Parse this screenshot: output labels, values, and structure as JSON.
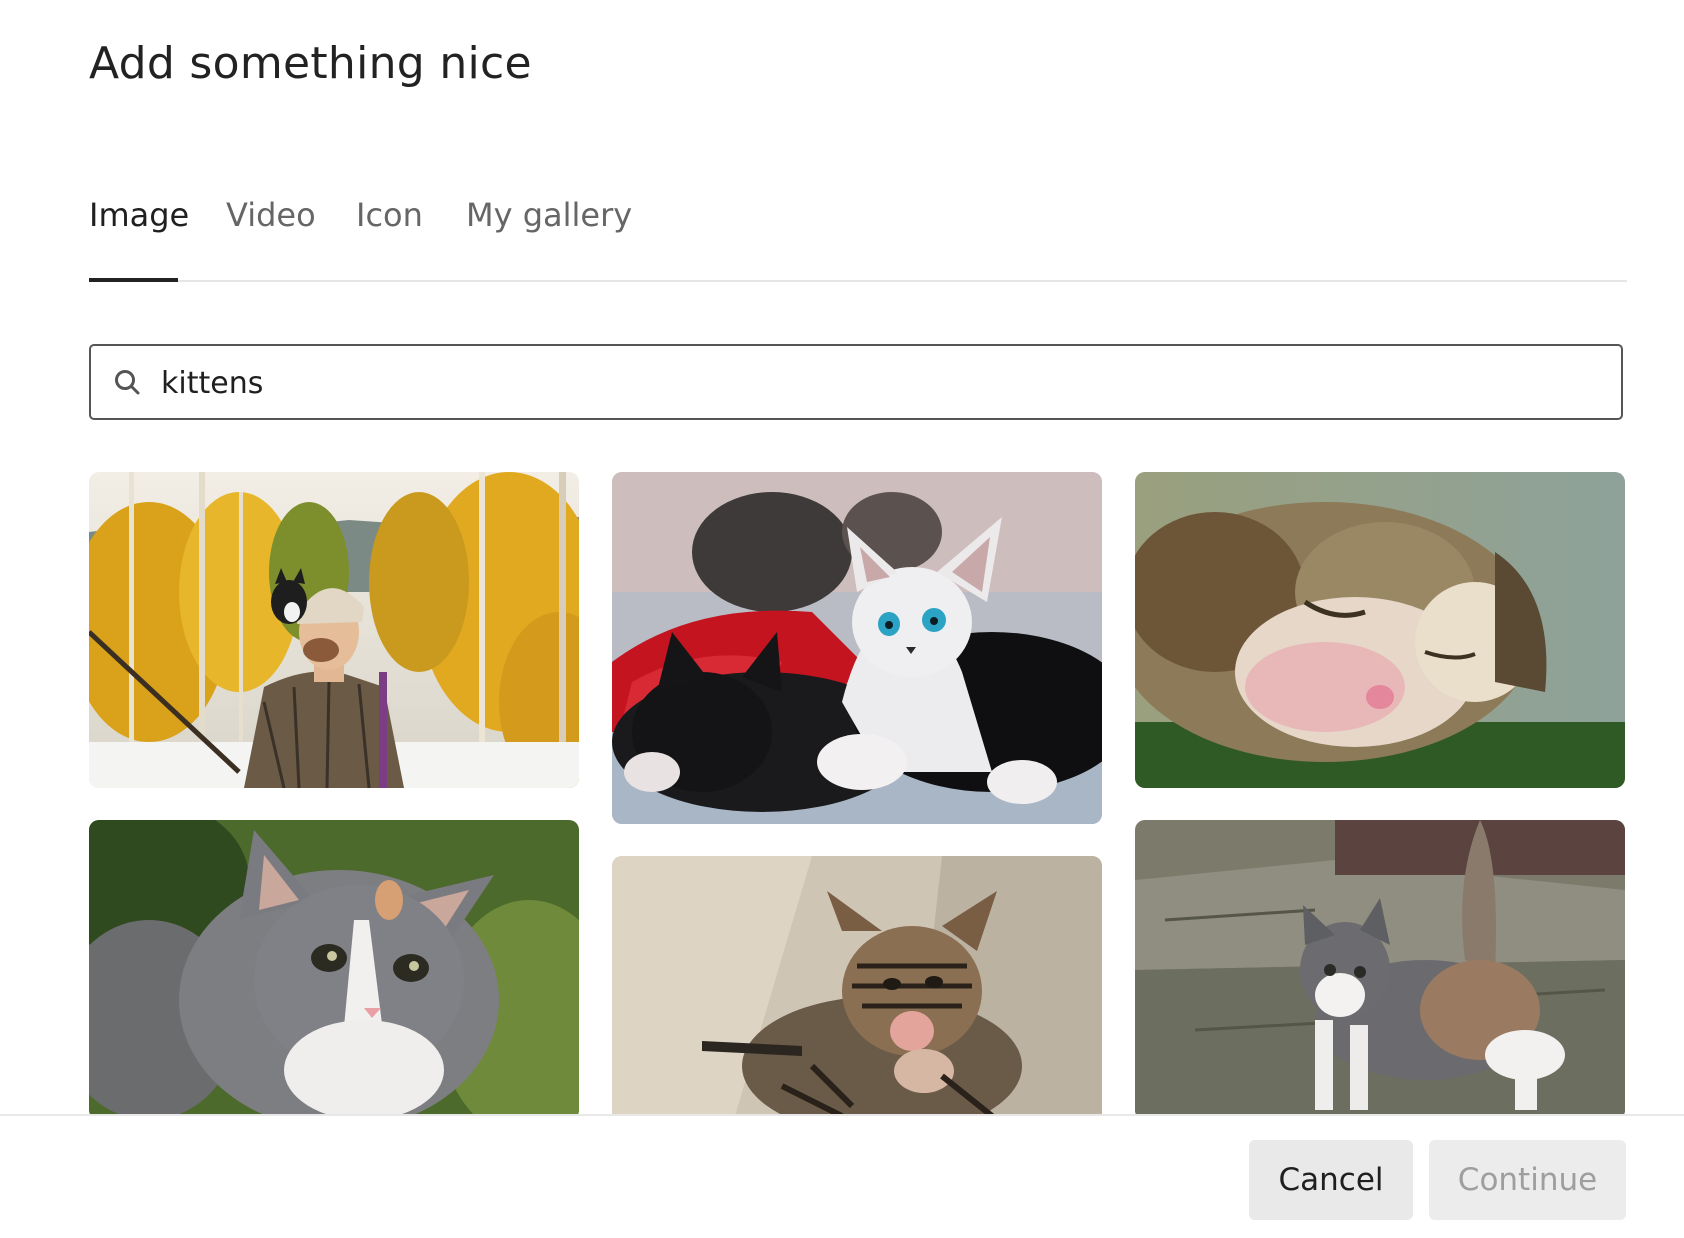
{
  "dialog": {
    "title": "Add something nice"
  },
  "tabs": [
    {
      "label": "Image",
      "active": true
    },
    {
      "label": "Video",
      "active": false
    },
    {
      "label": "Icon",
      "active": false
    },
    {
      "label": "My gallery",
      "active": false
    }
  ],
  "search": {
    "icon": "search-icon",
    "value": "kittens"
  },
  "results": [
    {
      "subject": "man-with-kitten-on-shoulder-autumn-forest"
    },
    {
      "subject": "white-and-black-kittens-on-red-blanket"
    },
    {
      "subject": "sleeping-calico-kitten-on-grass"
    },
    {
      "subject": "grey-white-kitten-in-grass"
    },
    {
      "subject": "tabby-kitten-licking-paw"
    },
    {
      "subject": "calico-kitten-on-stone-pavement"
    }
  ],
  "footer": {
    "cancel_label": "Cancel",
    "continue_label": "Continue",
    "continue_disabled": true
  },
  "colors": {
    "text": "#1f1f1f",
    "tab_inactive": "#666666",
    "button_bg": "#e9e9e9",
    "disabled_text": "#9e9e9e"
  }
}
